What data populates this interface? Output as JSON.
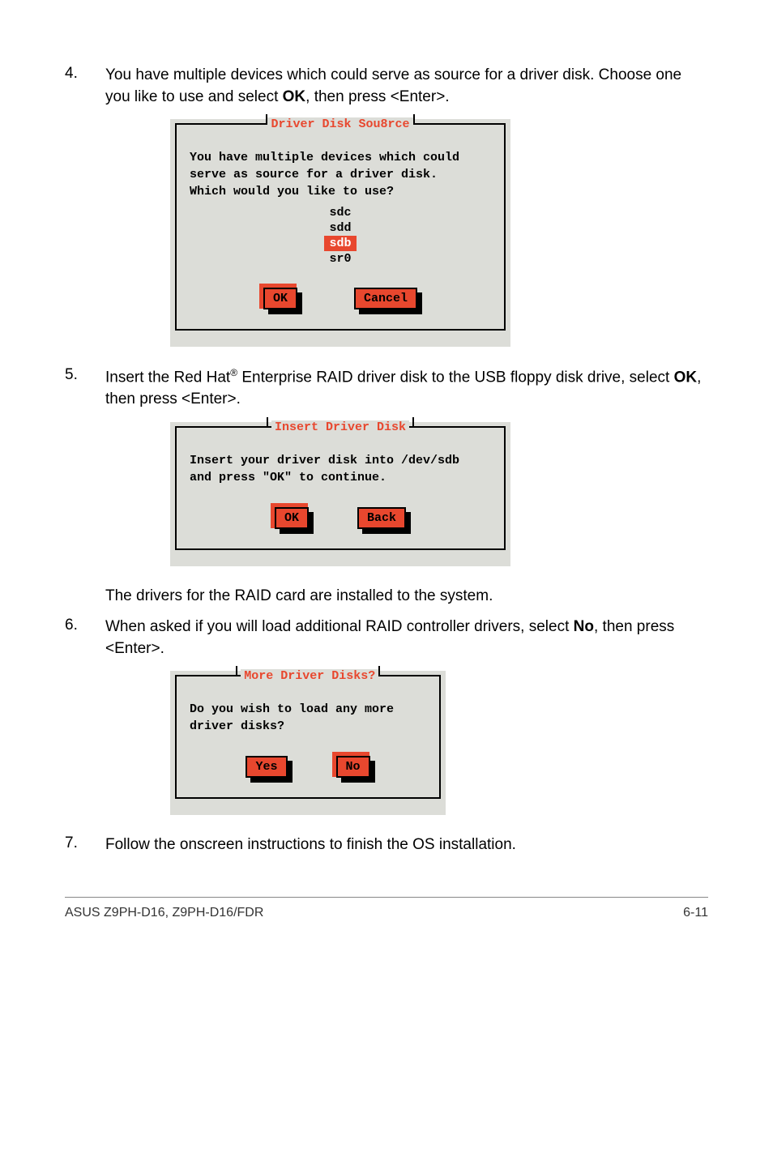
{
  "steps": {
    "s4": {
      "num": "4.",
      "text_a": "You have multiple devices which could serve as source for a driver disk. Choose one you like to use and select ",
      "text_b": "OK",
      "text_c": ", then press <Enter>."
    },
    "s5": {
      "num": "5.",
      "text_a": "Insert the Red Hat",
      "text_sup": "®",
      "text_b": " Enterprise RAID driver disk to the USB floppy disk drive, select ",
      "text_c": "OK",
      "text_d": ", then press <Enter>."
    },
    "s5_note": "The drivers for the RAID card are installed to the system.",
    "s6": {
      "num": "6.",
      "text_a": "When asked if you will load additional RAID controller drivers, select ",
      "text_b": "No",
      "text_c": ", then press <Enter>."
    },
    "s7": {
      "num": "7.",
      "text": "Follow the onscreen instructions to finish the OS installation."
    }
  },
  "dialog1": {
    "title": "Driver Disk Sou8rce",
    "line1": "You have multiple devices which could",
    "line2": "serve as source for a driver disk.",
    "line3": "Which would you like to use?",
    "items": {
      "i0": "sdc",
      "i1": "sdd",
      "i2": "sdb",
      "i3": "sr0"
    },
    "ok": "OK",
    "cancel": "Cancel"
  },
  "dialog2": {
    "title": "Insert Driver Disk",
    "line1": "Insert your driver disk into /dev/sdb",
    "line2": "and press \"OK\" to continue.",
    "ok": "OK",
    "back": "Back"
  },
  "dialog3": {
    "title": "More Driver Disks?",
    "line1": "Do you wish to load any more",
    "line2": "driver disks?",
    "yes": "Yes",
    "no": "No"
  },
  "footer": {
    "left": "ASUS Z9PH-D16, Z9PH-D16/FDR",
    "right": "6-11"
  }
}
